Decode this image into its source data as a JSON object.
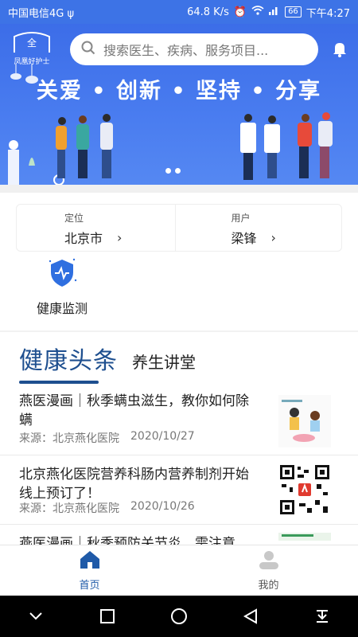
{
  "status_bar": {
    "carrier": "中国电信4G ψ",
    "speed": "64.8 K/s",
    "battery": "66",
    "time": "下午4:27"
  },
  "banner": {
    "logo_text": "凤凰好护士",
    "search_placeholder": "搜索医生、疾病、服务项目...",
    "slogan": "关爱 • 创新 • 坚持 • 分享"
  },
  "info": {
    "location_label": "定位",
    "location_value": "北京市",
    "user_label": "用户",
    "user_value": "梁锋"
  },
  "services": {
    "health_monitor_label": "健康监测"
  },
  "tabs": {
    "active": "健康头条",
    "other": "养生讲堂"
  },
  "news": [
    {
      "title": "燕医漫画｜秋季螨虫滋生，教你如何除螨",
      "source": "来源：北京燕化医院",
      "date": "2020/10/27"
    },
    {
      "title": "北京燕化医院营养科肠内营养制剂开始线上预订了！",
      "source": "来源：北京燕化医院",
      "date": "2020/10/26"
    },
    {
      "title": "燕医漫画｜秋季预防关节炎，需注意",
      "source": "",
      "date": ""
    }
  ],
  "bottom_nav": {
    "home": "首页",
    "mine": "我的"
  },
  "colors": {
    "brand_blue": "#3d73e6",
    "tab_blue": "#1e4f8f",
    "nav_active": "#1f5aa8"
  }
}
